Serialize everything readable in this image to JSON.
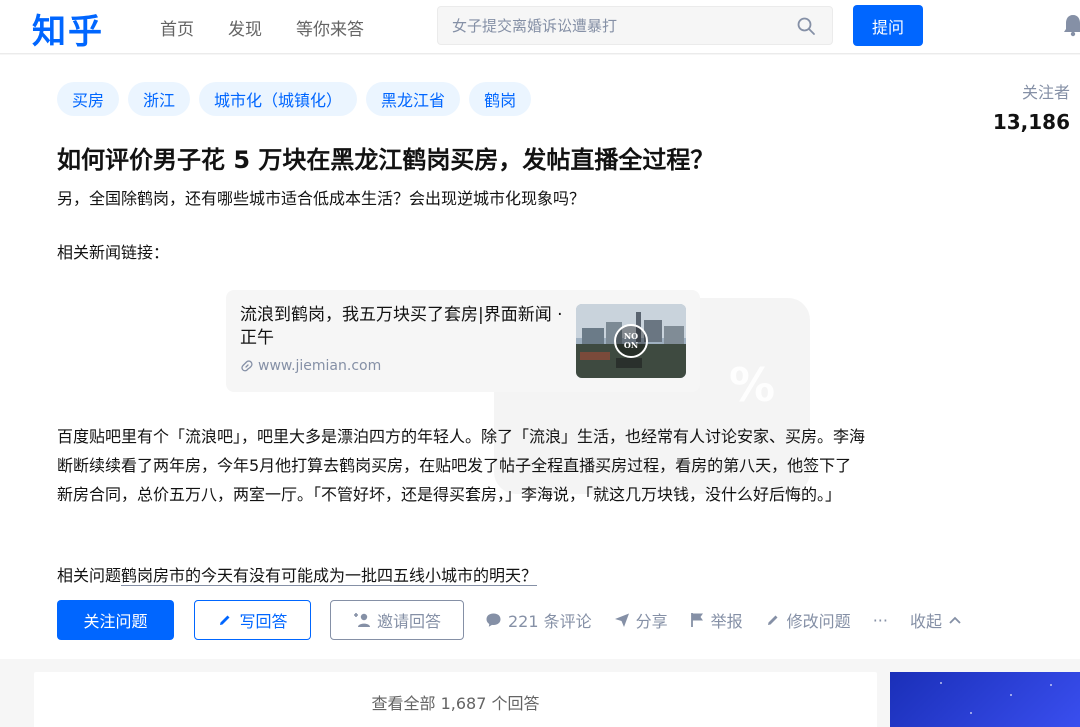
{
  "header": {
    "logo": "知乎",
    "nav": [
      "首页",
      "发现",
      "等你来答"
    ],
    "search_placeholder": "女子提交离婚诉讼遭暴打",
    "ask_label": "提问"
  },
  "question": {
    "topics": [
      "买房",
      "浙江",
      "城市化（城镇化）",
      "黑龙江省",
      "鹤岗"
    ],
    "followers_label": "关注者",
    "followers_count": "13,186",
    "title": "如何评价男子花 5 万块在黑龙江鹤岗买房，发帖直播全过程？",
    "detail_line1": "另，全国除鹤岗，还有哪些城市适合低成本生活？会出现逆城市化现象吗？",
    "news_label": "相关新闻链接：",
    "link_card": {
      "title": "流浪到鹤岗，我五万块买了套房|界面新闻 · 正午",
      "url": "www.jiemian.com"
    },
    "watermark": "%",
    "body": "百度贴吧里有个「流浪吧」，吧里大多是漂泊四方的年轻人。除了「流浪」生活，也经常有人讨论安家、买房。李海断断续续看了两年房，今年5月他打算去鹤岗买房，在贴吧发了帖子全程直播买房过程，看房的第八天，他签下了新房合同，总价五万八，两室一厅。「不管好坏，还是得买套房，」李海说，「就这几万块钱，没什么好后悔的。」",
    "related_prefix": "相关问题",
    "related_link": "鹤岗房市的今天有没有可能成为一批四五线小城市的明天？"
  },
  "actions": {
    "follow": "关注问题",
    "write": "写回答",
    "invite": "邀请回答",
    "comments": "221 条评论",
    "share": "分享",
    "report": "举报",
    "edit": "修改问题",
    "more": "···",
    "collapse": "收起"
  },
  "answers": {
    "view_all": "查看全部 1,687 个回答"
  },
  "colors": {
    "brand": "#0066ff",
    "muted": "#8590a6",
    "topic_bg": "#ebf5ff"
  }
}
